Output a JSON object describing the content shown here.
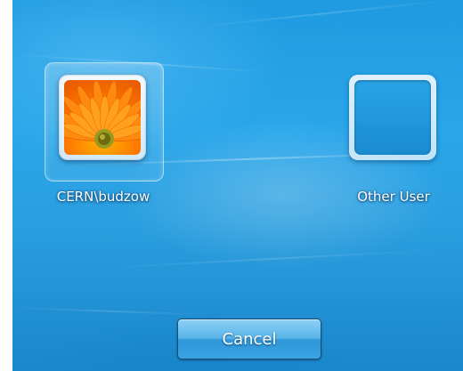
{
  "users": [
    {
      "name": "CERN\\budzow",
      "picture": "orange-gerbera-flower",
      "selected": true
    },
    {
      "name": "Other User",
      "picture": "blank-user-frame",
      "selected": false
    }
  ],
  "actions": {
    "cancel_label": "Cancel"
  },
  "colors": {
    "background": "#2aa6ea",
    "button": "#4aaee6",
    "text": "#ffffff"
  }
}
